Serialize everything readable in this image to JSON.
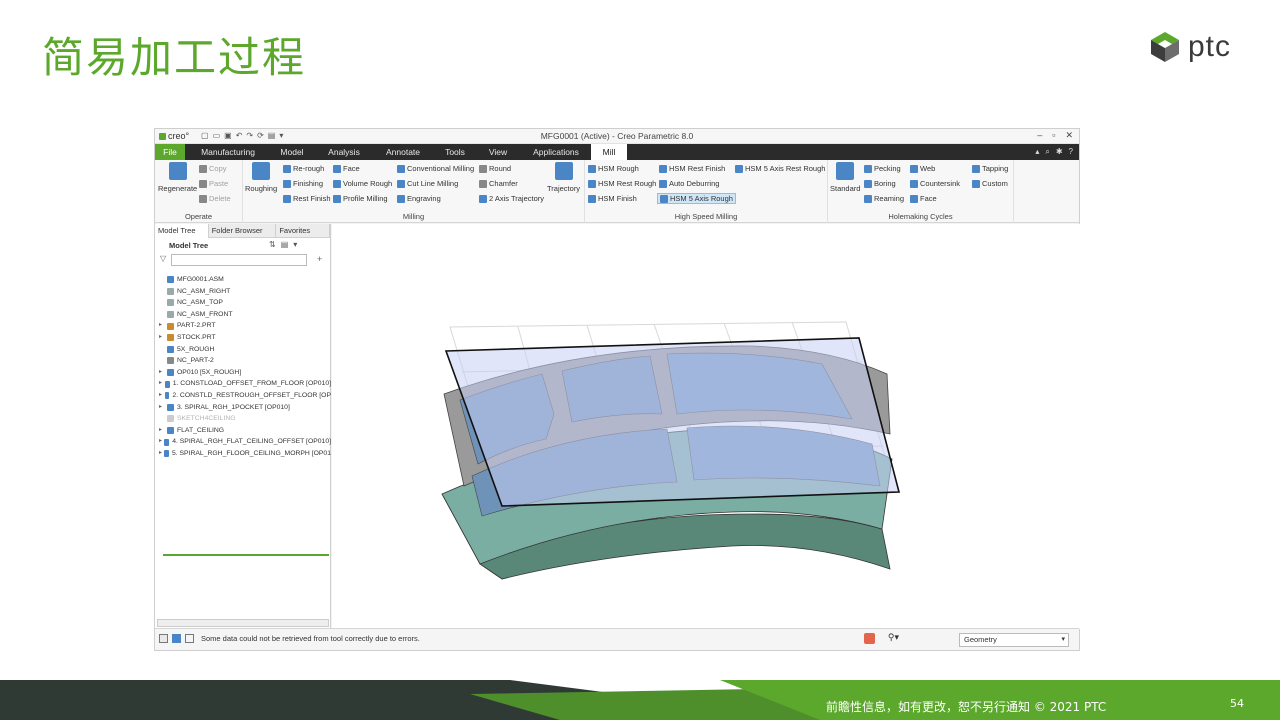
{
  "slide": {
    "title": "简易加工过程",
    "logo_text": "ptc",
    "footer": "前瞻性信息，如有更改，恕不另行通知 © 2021 PTC",
    "page_number": "54",
    "colors": {
      "brand_green": "#5ba82c",
      "dark_band": "#2f3a35"
    }
  },
  "app": {
    "logo": "creo°",
    "window_title": "MFG0001 (Active) - Creo Parametric 8.0",
    "tabs": [
      "File",
      "Manufacturing",
      "Model",
      "Analysis",
      "Annotate",
      "Tools",
      "View",
      "Applications",
      "Mill"
    ],
    "active_tab": "Mill",
    "ribbon": {
      "operate": {
        "label": "Operate",
        "regenerate": "Regenerate",
        "copy": "Copy",
        "paste": "Paste",
        "delete": "Delete"
      },
      "milling": {
        "label": "Milling",
        "roughing": "Roughing",
        "rerough": "Re-rough",
        "finishing": "Finishing",
        "rest_finish": "Rest Finish",
        "face": "Face",
        "volume_rough": "Volume Rough",
        "profile_milling": "Profile Milling",
        "conventional_milling": "Conventional Milling",
        "cut_line_milling": "Cut Line Milling",
        "engraving": "Engraving",
        "round": "Round",
        "chamfer": "Chamfer",
        "two_axis_trajectory": "2 Axis Trajectory",
        "trajectory": "Trajectory"
      },
      "hsm": {
        "label": "High Speed Milling",
        "hsm_rough": "HSM Rough",
        "hsm_rest_rough": "HSM Rest Rough",
        "hsm_finish": "HSM Finish",
        "hsm_rest_finish": "HSM Rest Finish",
        "auto_deburring": "Auto Deburring",
        "hsm_5axis_rough": "HSM 5 Axis Rough",
        "hsm_5axis_rest_rough": "HSM 5 Axis Rest Rough"
      },
      "holemaking": {
        "label": "Holemaking Cycles",
        "standard": "Standard",
        "pecking": "Pecking",
        "boring": "Boring",
        "reaming": "Reaming",
        "web": "Web",
        "countersink": "Countersink",
        "face": "Face",
        "tapping": "Tapping",
        "custom": "Custom"
      }
    },
    "panel": {
      "tabs": [
        "Model Tree",
        "Folder Browser",
        "Favorites"
      ],
      "header": "Model Tree",
      "tree": [
        {
          "label": "MFG0001.ASM",
          "exp": "",
          "color": "#4a86c5",
          "faded": false
        },
        {
          "label": "NC_ASM_RIGHT",
          "exp": "",
          "color": "#9aa",
          "faded": false
        },
        {
          "label": "NC_ASM_TOP",
          "exp": "",
          "color": "#9aa",
          "faded": false
        },
        {
          "label": "NC_ASM_FRONT",
          "exp": "",
          "color": "#9aa",
          "faded": false
        },
        {
          "label": "PART-2.PRT",
          "exp": "▸",
          "color": "#c98b2b",
          "faded": false
        },
        {
          "label": "STOCK.PRT",
          "exp": "▸",
          "color": "#c98b2b",
          "faded": false
        },
        {
          "label": "5X_ROUGH",
          "exp": "",
          "color": "#4a86c5",
          "faded": false
        },
        {
          "label": "NC_PART-2",
          "exp": "",
          "color": "#888",
          "faded": false
        },
        {
          "label": "OP010 [5X_ROUGH]",
          "exp": "▸",
          "color": "#4a86c5",
          "faded": false
        },
        {
          "label": "1. CONSTLOAD_OFFSET_FROM_FLOOR [OP010]",
          "exp": "▸",
          "color": "#4a86c5",
          "faded": false
        },
        {
          "label": "2. CONSTLD_RESTROUGH_OFFSET_FLOOR [OP",
          "exp": "▸",
          "color": "#4a86c5",
          "faded": false
        },
        {
          "label": "3. SPIRAL_RGH_1POCKET [OP010]",
          "exp": "▸",
          "color": "#4a86c5",
          "faded": false
        },
        {
          "label": "SKETCH4CEILING",
          "exp": "",
          "color": "#ccc",
          "faded": true
        },
        {
          "label": "FLAT_CEILING",
          "exp": "▸",
          "color": "#4a86c5",
          "faded": false
        },
        {
          "label": "4. SPIRAL_RGH_FLAT_CEILING_OFFSET [OP010]",
          "exp": "▸",
          "color": "#4a86c5",
          "faded": false
        },
        {
          "label": "5. SPIRAL_RGH_FLOOR_CEILING_MORPH [OP01",
          "exp": "▸",
          "color": "#4a86c5",
          "faded": false
        }
      ]
    },
    "status": {
      "message": "Some data could not be retrieved from tool correctly due to errors.",
      "filter": "Geometry"
    }
  }
}
